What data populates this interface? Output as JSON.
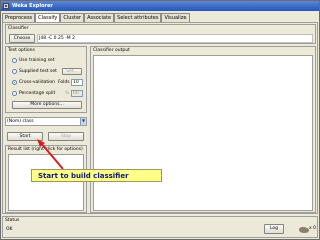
{
  "window": {
    "title": "Weka Explorer"
  },
  "tabs": [
    "Preprocess",
    "Classify",
    "Cluster",
    "Associate",
    "Select attributes",
    "Visualize"
  ],
  "classifier": {
    "section_title": "Classifier",
    "choose_label": "Choose",
    "value": "J48 -C 0.25 -M 2"
  },
  "test_options": {
    "section_title": "Test options",
    "use_training_set": "Use training set",
    "supplied_test_set": "Supplied test set",
    "set_label": "Set...",
    "cross_validation": "Cross-validation",
    "folds_label": "Folds",
    "folds_value": "10",
    "percentage_split": "Percentage split",
    "percent_label": "%",
    "percent_value": "66",
    "more_options_label": "More options...",
    "selected": "cross_validation"
  },
  "class_select": {
    "value": "(Nom) class"
  },
  "run": {
    "start_label": "Start",
    "stop_label": "Stop"
  },
  "result_list": {
    "title": "Result list (right-click for options)"
  },
  "output": {
    "title": "Classifier output"
  },
  "callout": {
    "text": "Start to build classifier"
  },
  "status": {
    "section_title": "Status",
    "text": "OK",
    "log_label": "Log",
    "x_count": "x 0"
  }
}
